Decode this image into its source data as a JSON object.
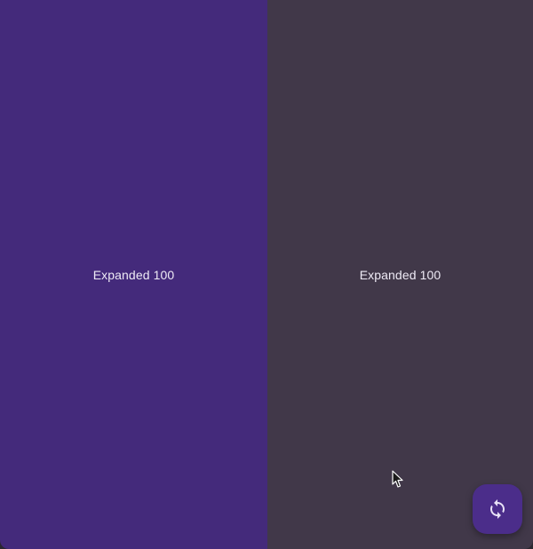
{
  "panels": [
    {
      "label": "Expanded 100",
      "color": "#442a7b"
    },
    {
      "label": "Expanded 100",
      "color": "#413849"
    }
  ],
  "fab": {
    "icon": "refresh-icon",
    "color": "#4b2d8a"
  },
  "cursor": {
    "icon": "mouse-pointer-icon"
  }
}
